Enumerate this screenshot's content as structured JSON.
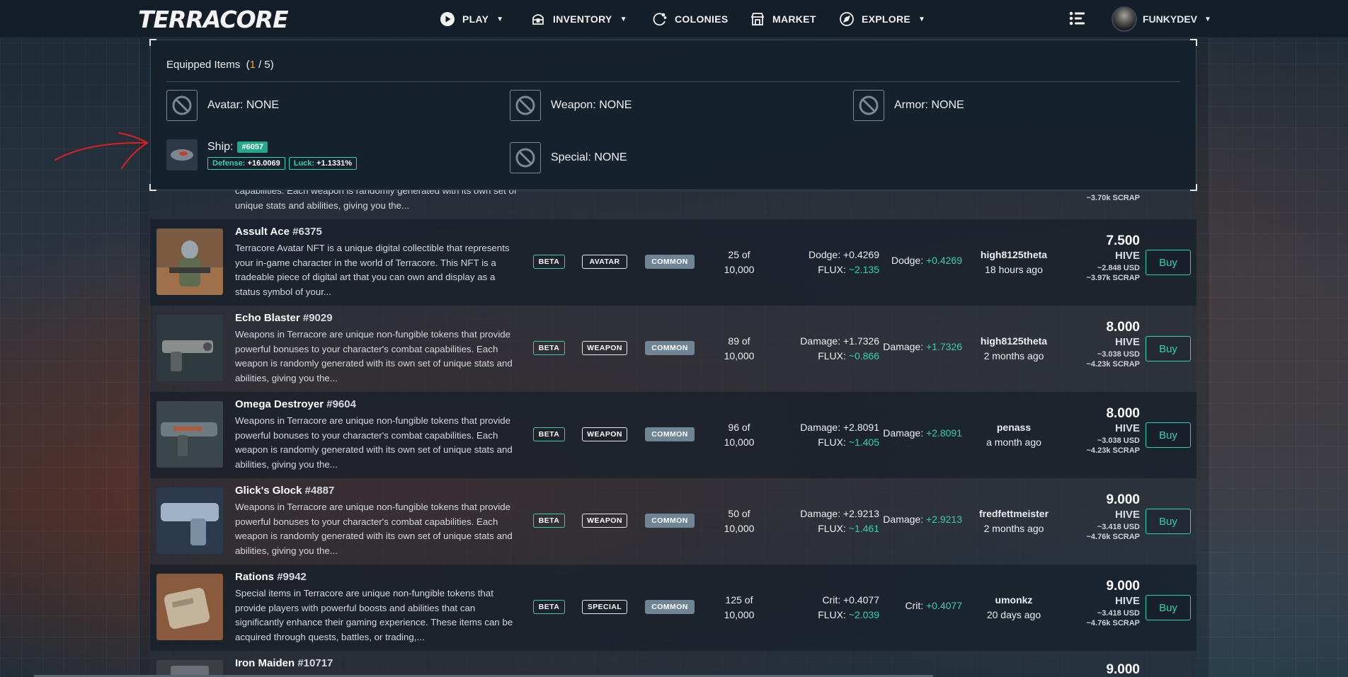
{
  "nav": {
    "logo": "TERRACORE",
    "items": [
      {
        "label": "PLAY",
        "caret": true
      },
      {
        "label": "INVENTORY",
        "caret": true
      },
      {
        "label": "COLONIES",
        "caret": false
      },
      {
        "label": "MARKET",
        "caret": false
      },
      {
        "label": "EXPLORE",
        "caret": true
      }
    ],
    "user": "FUNKYDEV"
  },
  "equipped": {
    "title": "Equipped Items",
    "count": "1",
    "total": "/ 5",
    "slots": {
      "avatar": "Avatar: NONE",
      "weapon": "Weapon: NONE",
      "armor": "Armor: NONE",
      "special": "Special: NONE"
    },
    "ship": {
      "label": "Ship:",
      "id": "#6057",
      "defense_label": "Defense:",
      "defense_value": "+16.0069",
      "luck_label": "Luck:",
      "luck_value": "+1.1331%"
    }
  },
  "partial_row": {
    "desc_lines": "capabilities. Each weapon is randomly generated with its own set of unique stats and abilities, giving you the...",
    "scrap": "~3.70k SCRAP"
  },
  "listings": [
    {
      "name": "Assult Ace",
      "number": "#6375",
      "desc": "Terracore Avatar NFT is a unique digital collectible that represents your in-game character in the world of Terracore. This NFT is a tradeable piece of digital art that you can own and display as a status symbol of your...",
      "beta": "BETA",
      "type": "AVATAR",
      "rarity": "COMMON",
      "supply_top": "25 of",
      "supply_bottom": "10,000",
      "stat_label": "Dodge:",
      "stat_value": "+0.4269",
      "flux_label": "FLUX:",
      "flux_value": "~2.135",
      "stat2_label": "Dodge:",
      "stat2_value": "+0.4269",
      "seller": "high8125theta",
      "time": "18 hours ago",
      "price": "7.500",
      "currency": "HIVE",
      "usd": "~2.848 USD",
      "scrap": "~3.97k SCRAP",
      "buy": "Buy"
    },
    {
      "name": "Echo Blaster",
      "number": "#9029",
      "desc": "Weapons in Terracore are unique non-fungible tokens that provide powerful bonuses to your character's combat capabilities. Each weapon is randomly generated with its own set of unique stats and abilities, giving you the...",
      "beta": "BETA",
      "type": "WEAPON",
      "rarity": "COMMON",
      "supply_top": "89 of",
      "supply_bottom": "10,000",
      "stat_label": "Damage:",
      "stat_value": "+1.7326",
      "flux_label": "FLUX:",
      "flux_value": "~0.866",
      "stat2_label": "Damage:",
      "stat2_value": "+1.7326",
      "seller": "high8125theta",
      "time": "2 months ago",
      "price": "8.000",
      "currency": "HIVE",
      "usd": "~3.038 USD",
      "scrap": "~4.23k SCRAP",
      "buy": "Buy"
    },
    {
      "name": "Omega Destroyer",
      "number": "#9604",
      "desc": "Weapons in Terracore are unique non-fungible tokens that provide powerful bonuses to your character's combat capabilities. Each weapon is randomly generated with its own set of unique stats and abilities, giving you the...",
      "beta": "BETA",
      "type": "WEAPON",
      "rarity": "COMMON",
      "supply_top": "96 of",
      "supply_bottom": "10,000",
      "stat_label": "Damage:",
      "stat_value": "+2.8091",
      "flux_label": "FLUX:",
      "flux_value": "~1.405",
      "stat2_label": "Damage:",
      "stat2_value": "+2.8091",
      "seller": "penass",
      "time": "a month ago",
      "price": "8.000",
      "currency": "HIVE",
      "usd": "~3.038 USD",
      "scrap": "~4.23k SCRAP",
      "buy": "Buy"
    },
    {
      "name": "Glick's Glock",
      "number": "#4887",
      "desc": "Weapons in Terracore are unique non-fungible tokens that provide powerful bonuses to your character's combat capabilities. Each weapon is randomly generated with its own set of unique stats and abilities, giving you the...",
      "beta": "BETA",
      "type": "WEAPON",
      "rarity": "COMMON",
      "supply_top": "50 of",
      "supply_bottom": "10,000",
      "stat_label": "Damage:",
      "stat_value": "+2.9213",
      "flux_label": "FLUX:",
      "flux_value": "~1.461",
      "stat2_label": "Damage:",
      "stat2_value": "+2.9213",
      "seller": "fredfettmeister",
      "time": "2 months ago",
      "price": "9.000",
      "currency": "HIVE",
      "usd": "~3.418 USD",
      "scrap": "~4.76k SCRAP",
      "buy": "Buy"
    },
    {
      "name": "Rations",
      "number": "#9942",
      "desc": "Special items in Terracore are unique non-fungible tokens that provide players with powerful boosts and abilities that can significantly enhance their gaming experience. These items can be acquired through quests, battles, or trading,...",
      "beta": "BETA",
      "type": "SPECIAL",
      "rarity": "COMMON",
      "supply_top": "125 of",
      "supply_bottom": "10,000",
      "stat_label": "Crit:",
      "stat_value": "+0.4077",
      "flux_label": "FLUX:",
      "flux_value": "~2.039",
      "stat2_label": "Crit:",
      "stat2_value": "+0.4077",
      "seller": "umonkz",
      "time": "20 days ago",
      "price": "9.000",
      "currency": "HIVE",
      "usd": "~3.418 USD",
      "scrap": "~4.76k SCRAP",
      "buy": "Buy"
    },
    {
      "name": "Iron Maiden",
      "number": "#10717",
      "price": "9.000"
    }
  ],
  "colors": {
    "accent": "#2fd3a8",
    "highlight": "#f2a52b",
    "nav_bg": "#141e28",
    "annotation": "#e02020"
  }
}
